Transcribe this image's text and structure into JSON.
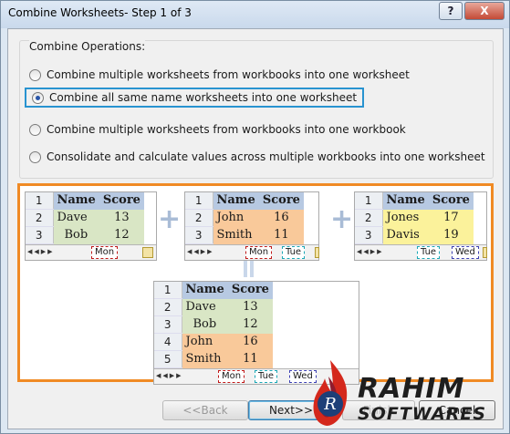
{
  "window": {
    "title": "Combine Worksheets- Step 1 of 3",
    "help_label": "?",
    "close_label": "X"
  },
  "operations": {
    "legend": "Combine Operations:",
    "options": [
      {
        "label": "Combine multiple worksheets from workbooks into one worksheet",
        "selected": false
      },
      {
        "label": "Combine all same name worksheets into one worksheet",
        "selected": true
      },
      {
        "label": "Combine multiple worksheets from workbooks into one workbook",
        "selected": false
      },
      {
        "label": "Consolidate and calculate values across multiple workbooks into one worksheet",
        "selected": false
      }
    ]
  },
  "illustration": {
    "header": {
      "name": "Name",
      "score": "Score"
    },
    "sheets": [
      {
        "rows": [
          [
            "1"
          ],
          [
            "2",
            "Dave",
            "13"
          ],
          [
            "3",
            "Bob",
            "12"
          ]
        ],
        "tabs": [
          "Mon"
        ]
      },
      {
        "rows": [
          [
            "1"
          ],
          [
            "2",
            "John",
            "16"
          ],
          [
            "3",
            "Smith",
            "11"
          ]
        ],
        "tabs": [
          "Mon",
          "Tue"
        ]
      },
      {
        "rows": [
          [
            "1"
          ],
          [
            "2",
            "Jones",
            "17"
          ],
          [
            "3",
            "Davis",
            "19"
          ]
        ],
        "tabs": [
          "Tue",
          "Wed"
        ]
      }
    ],
    "result": {
      "rows": [
        [
          "1"
        ],
        [
          "2",
          "Dave",
          "13"
        ],
        [
          "3",
          "Bob",
          "12"
        ],
        [
          "4",
          "John",
          "16"
        ],
        [
          "5",
          "Smith",
          "11"
        ]
      ],
      "tabs": [
        "Mon",
        "Tue",
        "Wed"
      ]
    },
    "plus": "+"
  },
  "buttons": {
    "back": "<<Back",
    "next": "Next>>",
    "finish": "Finish",
    "cancel": "Cancel"
  },
  "watermark": {
    "line1": "RAHIM",
    "line2": "SOFTWARES",
    "monogram": "R"
  },
  "colors": {
    "highlight_border": "#2893d0",
    "illustration_border": "#f08a24",
    "header_fill": "#b7c9e2",
    "green_fill": "#d9e6c5",
    "orange_fill": "#f9c99a",
    "yellow_fill": "#fbf29b"
  }
}
